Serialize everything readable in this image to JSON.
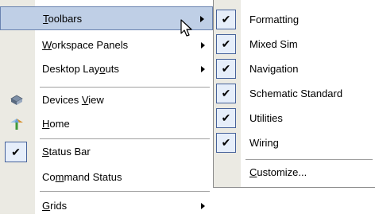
{
  "main_menu": {
    "items": [
      {
        "label": "Toolbars",
        "highlighted": true,
        "has_submenu": true
      },
      {
        "label": "Workspace Panels",
        "has_submenu": true
      },
      {
        "label": "Desktop Layouts",
        "has_submenu": true
      },
      {
        "label": "Devices View",
        "icon": "devices-view-icon"
      },
      {
        "label": "Home",
        "icon": "home-icon"
      },
      {
        "label": "Status Bar",
        "checked": true
      },
      {
        "label": "Command Status"
      },
      {
        "label": "Grids",
        "has_submenu": true
      }
    ]
  },
  "submenu": {
    "items": [
      {
        "label": "Formatting",
        "checked": true
      },
      {
        "label": "Mixed Sim",
        "checked": true
      },
      {
        "label": "Navigation",
        "checked": true
      },
      {
        "label": "Schematic Standard",
        "checked": true
      },
      {
        "label": "Utilities",
        "checked": true
      },
      {
        "label": "Wiring",
        "checked": true
      },
      {
        "label": "Customize..."
      }
    ]
  },
  "colors": {
    "highlight_bg": "#bfcfe6",
    "highlight_border": "#6a83b0",
    "gutter": "#ebeae3",
    "check_frame": "#46629a"
  }
}
